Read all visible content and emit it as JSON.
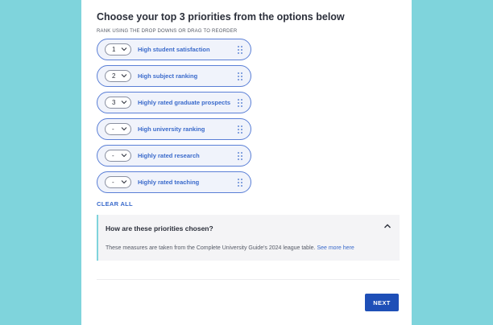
{
  "heading": "Choose your top 3 priorities from the options below",
  "subheading": "RANK USING THE DROP DOWNS OR DRAG TO REORDER",
  "priorities": [
    {
      "rank": "1",
      "label": "High student satisfaction"
    },
    {
      "rank": "2",
      "label": "High subject ranking"
    },
    {
      "rank": "3",
      "label": "Highly rated graduate prospects"
    },
    {
      "rank": "-",
      "label": "High university ranking"
    },
    {
      "rank": "-",
      "label": "Highly rated research"
    },
    {
      "rank": "-",
      "label": "Highly rated teaching"
    }
  ],
  "clear_all": "CLEAR ALL",
  "accordion": {
    "title": "How are these priorities chosen?",
    "body": "These measures are taken from the Complete University Guide's 2024 league table.",
    "link": "See more here"
  },
  "next_label": "NEXT",
  "colors": {
    "background": "#7fd4dc",
    "accent": "#3a6acb",
    "button": "#1e4fb7"
  },
  "icons": {
    "select_arrow": "chevron-down-icon",
    "drag": "drag-handle-icon",
    "accordion_toggle": "chevron-up-icon"
  }
}
